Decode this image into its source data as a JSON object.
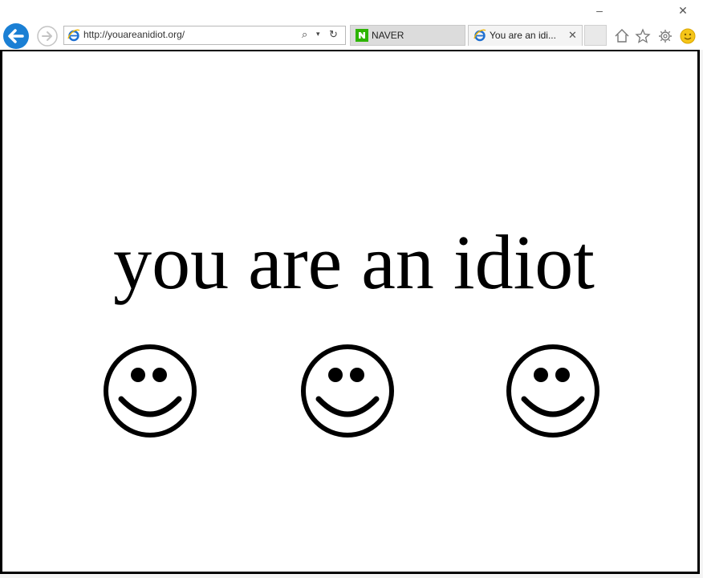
{
  "window": {
    "minimize_glyph": "–",
    "close_glyph": "✕"
  },
  "navbar": {
    "address": "http://youareanidiot.org/",
    "back_icon": "back-arrow-icon",
    "forward_icon": "forward-arrow-icon"
  },
  "tabs": [
    {
      "label": "NAVER",
      "icon": "naver-icon",
      "active": false
    },
    {
      "label": "You are an idi...",
      "icon": "ie-icon",
      "active": true
    }
  ],
  "toolbar_icons": [
    "home-icon",
    "star-icon",
    "gear-icon",
    "smiley-feedback-icon"
  ],
  "page": {
    "headline": "you are an idiot",
    "smileys": [
      "smiley-face",
      "smiley-face",
      "smiley-face"
    ]
  },
  "colors": {
    "back_button": "#1a7fd4",
    "naver_green": "#2db400",
    "ie_blue": "#1e6fd0",
    "feedback_yellow": "#f5c518"
  }
}
